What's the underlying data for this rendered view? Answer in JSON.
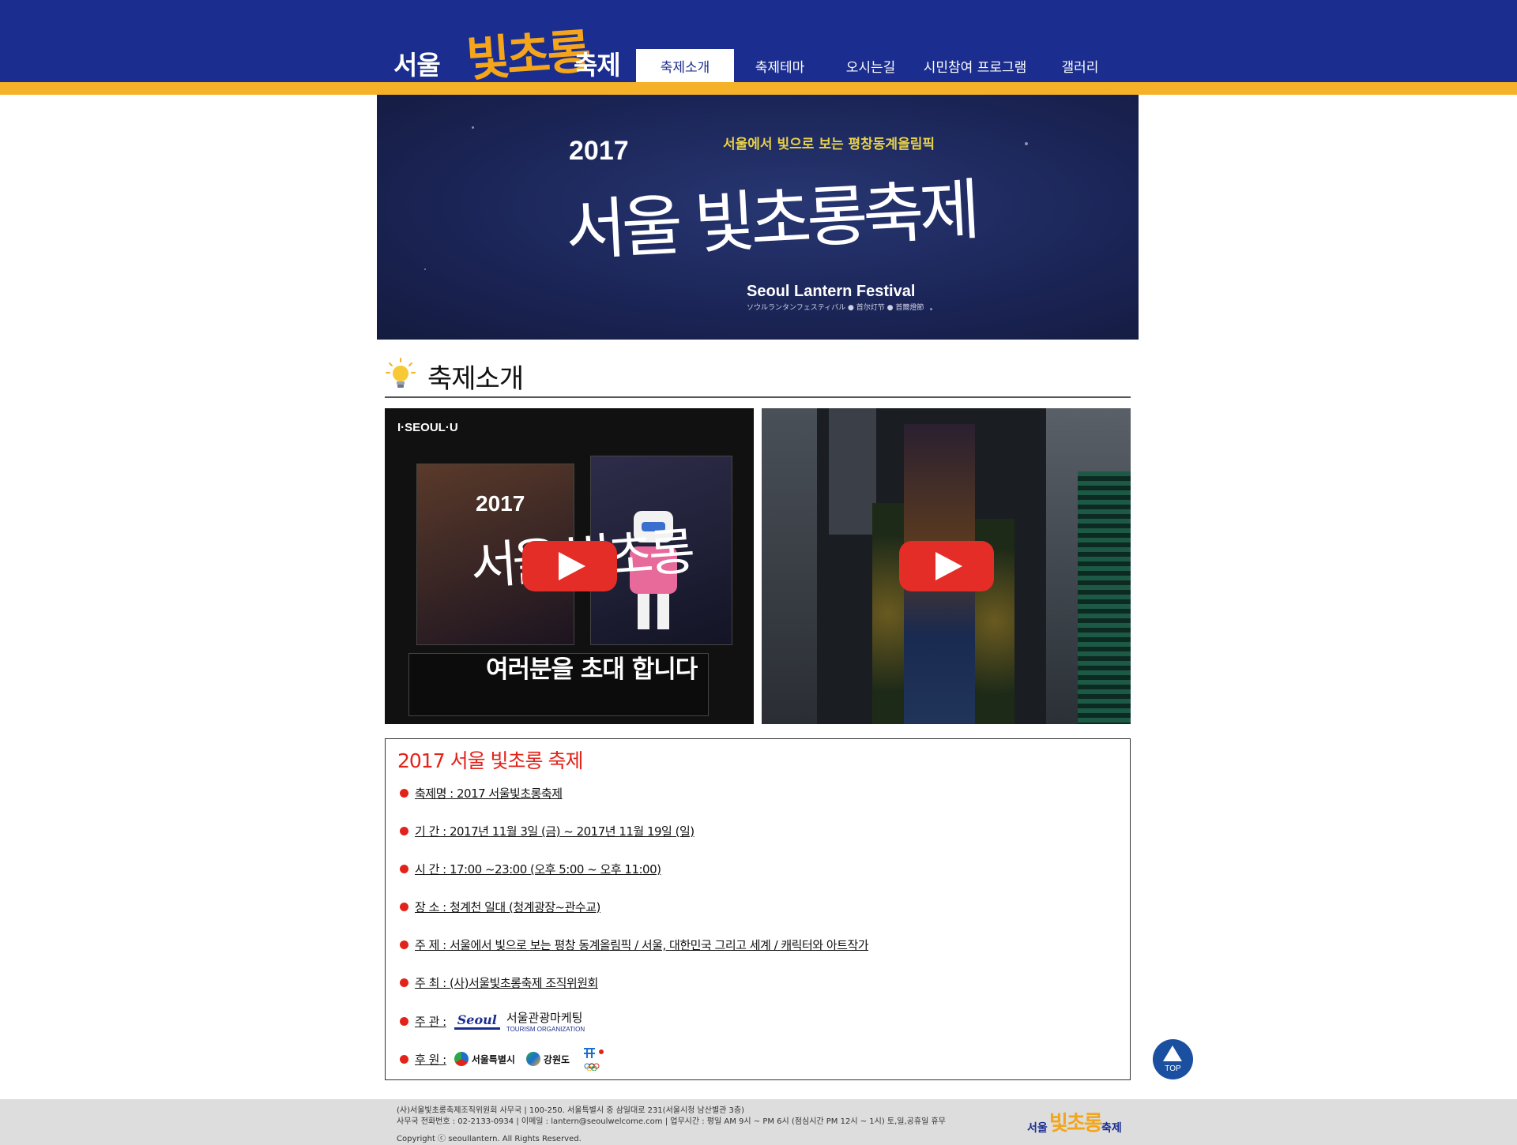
{
  "header": {
    "logo": {
      "part1": "서울",
      "part2": "빛초롱",
      "part3": "축제"
    },
    "nav": [
      {
        "label": "축제소개",
        "active": true
      },
      {
        "label": "축제테마",
        "active": false
      },
      {
        "label": "오시는길",
        "active": false
      },
      {
        "label": "시민참여 프로그램",
        "active": false
      },
      {
        "label": "갤러리",
        "active": false
      }
    ]
  },
  "banner": {
    "year": "2017",
    "subtitle": "서울에서 빛으로 보는 평창동계올림픽",
    "title": "서울 빛초롱축제",
    "english": "Seoul Lantern Festival",
    "multilingual": "ソウルランタンフェスティバル ● 首尔灯节 ● 首爾燈節"
  },
  "section": {
    "title": "축제소개"
  },
  "videos": [
    {
      "brand": "I·SEOUL·U",
      "year": "2017",
      "title": "서울 빛초롱",
      "caption": "여러분을 초대 합니다"
    },
    {
      "brand": "",
      "year": "",
      "title": "",
      "caption": ""
    }
  ],
  "info": {
    "title": "2017 서울 빛초롱 축제",
    "rows": [
      "축제명 : 2017 서울빛초롱축제",
      "기   간 : 2017년 11월 3일 (금) ~ 2017년 11월 19일 (일)",
      "시   간 : 17:00 ~23:00 (오후 5:00 ~ 오후 11:00)",
      "장   소 : 청계천 일대 (청계광장~관수교)",
      "주   제 : 서울에서 빛으로 보는 평창 동계올림픽 / 서울, 대한민국 그리고 세계 / 캐릭터와 아트작가",
      "주   최 : (사)서울빛초롱축제 조직위원회"
    ],
    "organizer_label": "주   관 :",
    "organizer": {
      "mark": "Seoul",
      "name": "서울관광마케팅",
      "sub": "TOURISM ORGANIZATION"
    },
    "sponsor_label": "후   원 :",
    "sponsors": [
      "서울특별시",
      "강원도"
    ]
  },
  "top_button": {
    "label": "TOP"
  },
  "footer": {
    "line1": "(사)서울빛초롱축제조직위원회 사무국 | 100-250. 서울특별시 중 삼일대로 231(서울시청 남산별관 3층)",
    "line2": "사무국 전화번호 : 02-2133-0934 | 이메일 : lantern@seoulwelcome.com | 업무시간 : 평일 AM 9시 ~ PM 6시 (점심시간 PM 12시 ~ 1시) 토,일,공휴일 휴무",
    "copyright": "Copyright ⓒ seoullantern. All Rights Reserved.",
    "logo": {
      "part1": "서울",
      "part2": "빛초롱",
      "part3": "축제"
    }
  },
  "colors": {
    "header": "#1b2e8f",
    "accent": "#f5b228",
    "red": "#e2231a",
    "play": "#e52d27"
  }
}
